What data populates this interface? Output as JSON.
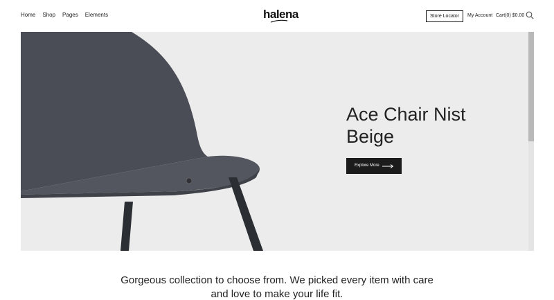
{
  "nav": {
    "items": [
      "Home",
      "Shop",
      "Pages",
      "Elements"
    ]
  },
  "brand": {
    "logo": "halena"
  },
  "header": {
    "store_locator": "Store Locator",
    "my_account": "My Account",
    "cart": "Cart(0) $0.00"
  },
  "hero": {
    "title_line1": "Ace Chair Nist",
    "title_line2": "Beige",
    "cta": "Explore More"
  },
  "intro": {
    "line1": "Gorgeous collection to choose from. We picked every item with care",
    "line2": "and love to make your life fit."
  },
  "icons": {
    "search": "search-icon",
    "arrow": "arrow-right-icon"
  },
  "colors": {
    "accent": "#1b1b1b",
    "hero_bg": "#ececec",
    "chair_fabric": "#4a4d55"
  }
}
